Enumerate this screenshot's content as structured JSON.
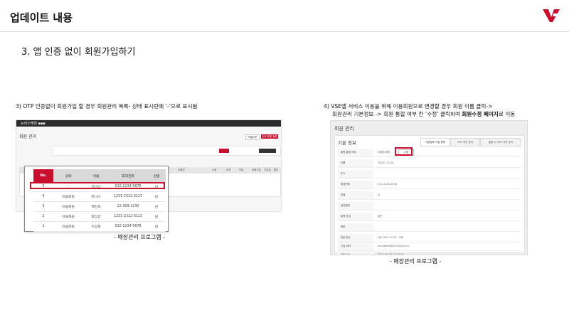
{
  "header": {
    "title": "업데이트 내용",
    "logo_icon": "vse-logo-icon",
    "accent_color": "#c8102e"
  },
  "section_title": "3. 앱 인증 없이 회원가입하기",
  "left": {
    "caption": "3) OTP 인증없이 회원가입 할 경우 회원관리 목록- 상태 표시란에 ‘-’으로 표시됨",
    "screenshot": {
      "brand": "뉴아스캐빗 ▪▪▪",
      "page_title": "회원 관리",
      "btn1": "엑셀다운",
      "btn2": "신규 회원 등록",
      "grid_headers": [
        "상품명",
        "수량",
        "금액",
        "적립",
        "회원구분",
        "가입일",
        "할인"
      ]
    },
    "overlay_table": {
      "headers": [
        "No.",
        "상태",
        "이름",
        "휴대전화",
        "성별"
      ],
      "rows": [
        [
          "5",
          "-",
          "가나다",
          "010-1234-5678",
          "남"
        ],
        [
          "4",
          "이용회원",
          "마니나",
          "1231-2312-3123",
          "남"
        ],
        [
          "3",
          "이용회원",
          "백진호",
          "12-309-1230",
          "남"
        ],
        [
          "2",
          "이용회원",
          "박상언",
          "1231-2312-3123",
          "남"
        ],
        [
          "1",
          "이용회원",
          "이상희",
          "010-1234-5678",
          "남"
        ]
      ]
    },
    "label": "- 매장관리 프로그램 -"
  },
  "right": {
    "caption_line1": "4) VSE앱 서비스 이용을 위해 이용회원으로 변경할 경우 회원 이름 클릭->",
    "caption_line2_pre": "회원관리 기본정보 -> 회원 통합 여부 칸 ‘수정’ 클릭하여 ",
    "caption_line2_bold": "회원수정 페이지",
    "caption_line2_post": "로 이동",
    "screenshot": {
      "title": "회원 관리",
      "subtitle": "기본 정보",
      "tabs": [
        "기본정보 가입 정보",
        "VSE 약관 동의",
        "통합 전 VSE 약관 동의"
      ],
      "rows": [
        {
          "key": "회원 통합 여부",
          "value": "미통합 회원",
          "edit": "수정"
        },
        {
          "key": "이름",
          "value": "가나다 (1234)"
        },
        {
          "key": "주소",
          "value": ""
        },
        {
          "key": "휴대전화",
          "value": "010-1234-5678"
        },
        {
          "key": "성별",
          "value": "남"
        },
        {
          "key": "생년월일",
          "value": ""
        },
        {
          "key": "회원 등급",
          "value": "일반 :"
        },
        {
          "key": "메모",
          "value": ""
        },
        {
          "key": "방문 횟수",
          "value": "0회 2024.12.20 - 0회"
        },
        {
          "key": "가입 위치",
          "value": "memberID@VSE0000123"
        },
        {
          "key": "가입 일시",
          "value": "2024.06.06 14:07:51"
        }
      ]
    },
    "label": "- 매장관리 프로그램 -"
  }
}
